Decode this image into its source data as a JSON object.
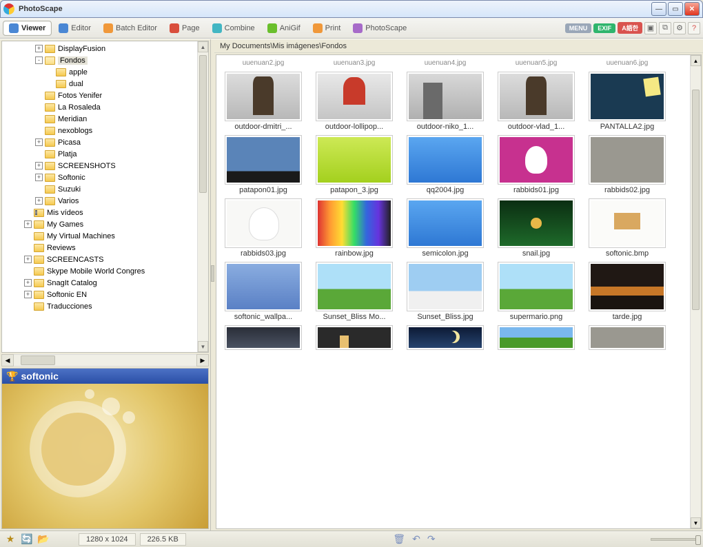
{
  "window": {
    "title": "PhotoScape"
  },
  "toolbar": {
    "tabs": [
      {
        "label": "Viewer",
        "active": true
      },
      {
        "label": "Editor",
        "active": false
      },
      {
        "label": "Batch Editor",
        "active": false
      },
      {
        "label": "Page",
        "active": false
      },
      {
        "label": "Combine",
        "active": false
      },
      {
        "label": "AniGif",
        "active": false
      },
      {
        "label": "Print",
        "active": false
      },
      {
        "label": "PhotoScape",
        "active": false
      }
    ],
    "badges": {
      "menu": "MENU",
      "exif": "EXIF",
      "lang": "A語한"
    }
  },
  "tree": [
    {
      "indent": 3,
      "exp": "+",
      "label": "DisplayFusion"
    },
    {
      "indent": 3,
      "exp": "-",
      "label": "Fondos",
      "open": true,
      "selected": true
    },
    {
      "indent": 4,
      "exp": "",
      "label": "apple"
    },
    {
      "indent": 4,
      "exp": "",
      "label": "dual"
    },
    {
      "indent": 3,
      "exp": "",
      "label": "Fotos Yenifer"
    },
    {
      "indent": 3,
      "exp": "",
      "label": "La Rosaleda"
    },
    {
      "indent": 3,
      "exp": "",
      "label": "Meridian"
    },
    {
      "indent": 3,
      "exp": "",
      "label": "nexoblogs"
    },
    {
      "indent": 3,
      "exp": "+",
      "label": "Picasa"
    },
    {
      "indent": 3,
      "exp": "",
      "label": "Platja"
    },
    {
      "indent": 3,
      "exp": "+",
      "label": "SCREENSHOTS"
    },
    {
      "indent": 3,
      "exp": "+",
      "label": "Softonic"
    },
    {
      "indent": 3,
      "exp": "",
      "label": "Suzuki"
    },
    {
      "indent": 3,
      "exp": "+",
      "label": "Varios"
    },
    {
      "indent": 2,
      "exp": "",
      "label": "Mis vídeos",
      "video": true
    },
    {
      "indent": 2,
      "exp": "+",
      "label": "My Games"
    },
    {
      "indent": 2,
      "exp": "",
      "label": "My Virtual Machines"
    },
    {
      "indent": 2,
      "exp": "",
      "label": "Reviews"
    },
    {
      "indent": 2,
      "exp": "+",
      "label": "SCREENCASTS"
    },
    {
      "indent": 2,
      "exp": "",
      "label": "Skype Mobile World Congres"
    },
    {
      "indent": 2,
      "exp": "+",
      "label": "SnagIt Catalog"
    },
    {
      "indent": 2,
      "exp": "+",
      "label": "Softonic EN"
    },
    {
      "indent": 2,
      "exp": "",
      "label": "Traducciones"
    }
  ],
  "preview": {
    "title": "softonic"
  },
  "breadcrumb": "My Documents\\Mis imágenes\\Fondos",
  "thumbnails": {
    "toprow": [
      "uuenuan2.jpg",
      "uuenuan3.jpg",
      "uuenuan4.jpg",
      "uuenuan5.jpg",
      "uuenuan6.jpg"
    ],
    "rows": [
      [
        {
          "label": "outdoor-dmitri_...",
          "art": "art-guy"
        },
        {
          "label": "outdoor-lollipop...",
          "art": "art-red"
        },
        {
          "label": "outdoor-niko_1...",
          "art": "art-city"
        },
        {
          "label": "outdoor-vlad_1...",
          "art": "art-guy"
        },
        {
          "label": "PANTALLA2.jpg",
          "art": "art-dark"
        }
      ],
      [
        {
          "label": "patapon01.jpg",
          "art": "art-pat"
        },
        {
          "label": "patapon_3.jpg",
          "art": "art-ylo"
        },
        {
          "label": "qq2004.jpg",
          "art": "art-blue"
        },
        {
          "label": "rabbids01.jpg",
          "art": "art-pink"
        },
        {
          "label": "rabbids02.jpg",
          "art": "art-gray"
        }
      ],
      [
        {
          "label": "rabbids03.jpg",
          "art": "art-white"
        },
        {
          "label": "rainbow.jpg",
          "art": "art-rainbow"
        },
        {
          "label": "semicolon.jpg",
          "art": "art-blue"
        },
        {
          "label": "snail.jpg",
          "art": "art-green"
        },
        {
          "label": "softonic.bmp",
          "art": "art-soft"
        }
      ],
      [
        {
          "label": "softonic_wallpa...",
          "art": "art-sblue"
        },
        {
          "label": "Sunset_Bliss Mo...",
          "art": "art-field"
        },
        {
          "label": "Sunset_Bliss.jpg",
          "art": "art-cloud"
        },
        {
          "label": "supermario.png",
          "art": "art-field"
        },
        {
          "label": "tarde.jpg",
          "art": "art-dusk"
        }
      ],
      [
        {
          "label": "",
          "art": "art-race"
        },
        {
          "label": "",
          "art": "art-char"
        },
        {
          "label": "",
          "art": "art-night"
        },
        {
          "label": "",
          "art": "art-bliss"
        },
        {
          "label": "",
          "art": "art-gray"
        }
      ]
    ]
  },
  "status": {
    "dimensions": "1280 x 1024",
    "filesize": "226.5 KB"
  },
  "colors": {
    "menu": "#9aa7b8",
    "exif": "#2fb56d",
    "lang": "#d9534f"
  }
}
